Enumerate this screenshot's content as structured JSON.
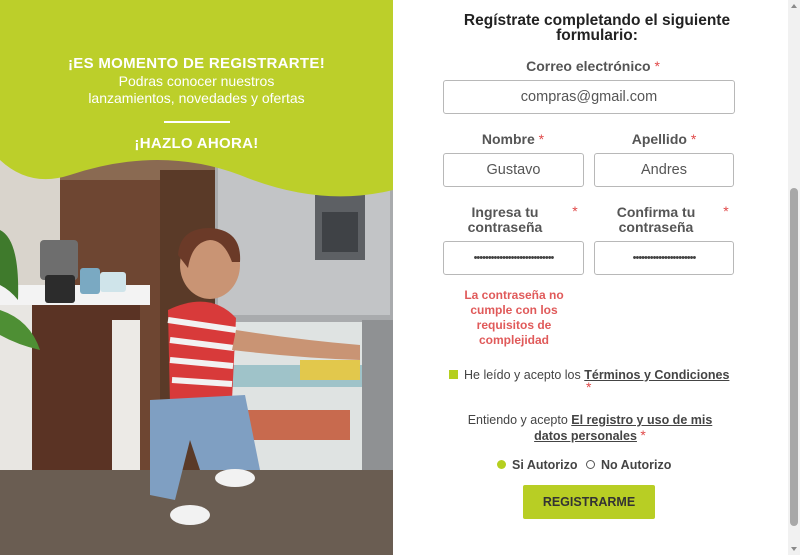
{
  "promo": {
    "title": "¡ES MOMENTO DE REGISTRARTE!",
    "subtitle_line1": "Podras conocer nuestros",
    "subtitle_line2": "lanzamientos, novedades y ofertas",
    "cta": "¡HAZLO AHORA!",
    "accent_color": "#bccf2a"
  },
  "form": {
    "title": "Regístrate completando el siguiente formulario:",
    "required_mark": "*",
    "email": {
      "label": "Correo electrónico",
      "value": "compras@gmail.com"
    },
    "first_name": {
      "label": "Nombre",
      "value": "Gustavo"
    },
    "last_name": {
      "label": "Apellido",
      "value": "Andres"
    },
    "password": {
      "label_line1": "Ingresa tu",
      "label_line2": "contraseña",
      "value": "••••••••••••••••••••••••••••"
    },
    "confirm_password": {
      "label_line1": "Confirma tu",
      "label_line2": "contraseña",
      "value": "••••••••••••••••••••••"
    },
    "password_error": "La contraseña no cumple con los requisitos de complejidad",
    "terms": {
      "prefix": "He leído y acepto los",
      "link": "Términos y Condiciones",
      "checked": true
    },
    "consent": {
      "prefix": "Entiendo y acepto",
      "link": "El registro y uso de mis datos personales"
    },
    "radio_yes": {
      "label": "Si Autorizo",
      "selected": true
    },
    "radio_no": {
      "label": "No Autorizo",
      "selected": false
    },
    "submit_label": "REGISTRARME",
    "error_color": "#e05a5a",
    "button_color": "#b8ce24"
  },
  "icons": [
    "checkbox-checked-icon",
    "radio-selected-icon",
    "radio-unselected-icon",
    "scroll-up-arrow-icon",
    "scroll-down-arrow-icon"
  ]
}
